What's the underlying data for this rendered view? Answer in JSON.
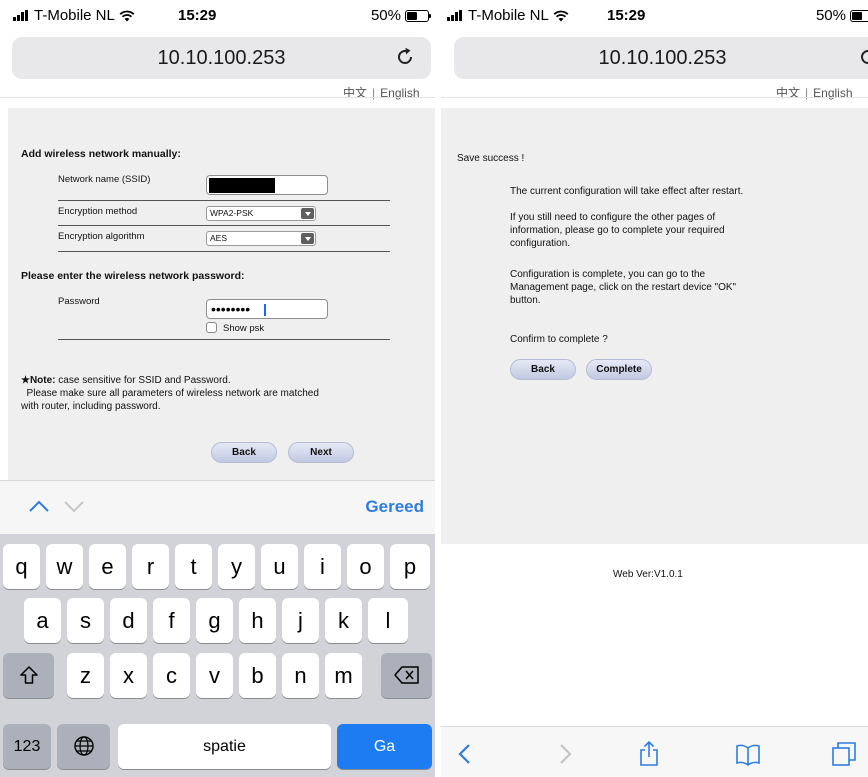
{
  "status": {
    "carrier": "T-Mobile NL",
    "time": "15:29",
    "battery": "50%"
  },
  "browser": {
    "url": "10.10.100.253"
  },
  "lang": {
    "chinese": "中文",
    "separator": "|",
    "english": "English"
  },
  "left_form": {
    "heading_manual": "Add wireless network manually:",
    "ssid_label": "Network name (SSID)",
    "encryption_method_label": "Encryption method",
    "encryption_method_value": "WPA2-PSK",
    "encryption_algorithm_label": "Encryption algorithm",
    "encryption_algorithm_value": "AES",
    "heading_password": "Please enter the wireless network password:",
    "password_label": "Password",
    "password_value": "••••••••",
    "show_psk_label": "Show psk",
    "note_bold": "★Note:",
    "note_text": " case sensitive for SSID and Password.",
    "note_line2": "  Please make sure all parameters of wireless network are matched",
    "note_line3": "with router,  including password.",
    "back_label": "Back",
    "next_label": "Next"
  },
  "accessory": {
    "done_label": "Gereed"
  },
  "keyboard": {
    "row1": [
      "q",
      "w",
      "e",
      "r",
      "t",
      "y",
      "u",
      "i",
      "o",
      "p"
    ],
    "row2": [
      "a",
      "s",
      "d",
      "f",
      "g",
      "h",
      "j",
      "k",
      "l"
    ],
    "row3": [
      "z",
      "x",
      "c",
      "v",
      "b",
      "n",
      "m"
    ],
    "numbers_label": "123",
    "space_label": "spatie",
    "go_label": "Ga"
  },
  "right_page": {
    "save_success": "Save success !",
    "p1": "The current configuration will take effect after restart.",
    "p2_line1": "If you still need to configure the other pages of",
    "p2_line2": "information,  please go to complete your required",
    "p2_line3": "configuration.",
    "p3_line1": "Configuration is complete,  you can go to the",
    "p3_line2": "Management page,  click on the restart device \"OK\"",
    "p3_line3": "button.",
    "confirm": "Confirm to complete ?",
    "back_label": "Back",
    "complete_label": "Complete",
    "web_version": "Web Ver:V1.0.1"
  }
}
